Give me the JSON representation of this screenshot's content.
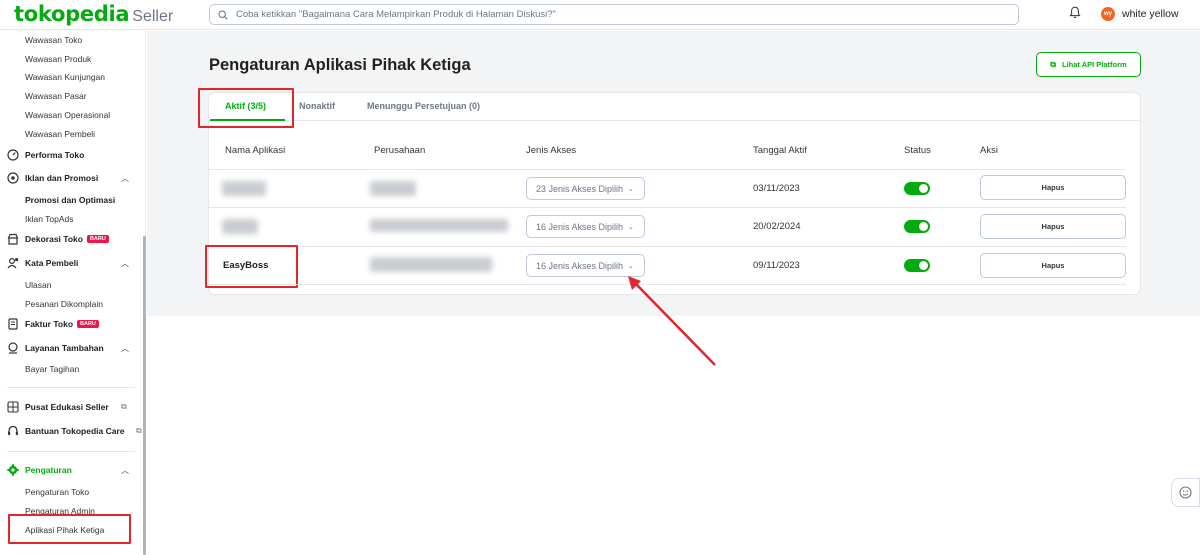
{
  "header": {
    "logo": "tokopedia",
    "logo_suffix": "Seller",
    "search_placeholder": "Coba ketikkan \"Bagaimana Cara Melampirkan Produk di Halaman Diskusi?\"",
    "avatar_text": "wy",
    "username": "white yellow"
  },
  "sidebar": {
    "wawasan_items": [
      "Wawasan Toko",
      "Wawasan Produk",
      "Wawasan Kunjungan",
      "Wawasan Pasar",
      "Wawasan Operasional",
      "Wawasan Pembeli"
    ],
    "performa": "Performa Toko",
    "iklan": "Iklan dan Promosi",
    "iklan_items": [
      "Promosi dan Optimasi",
      "Iklan TopAds"
    ],
    "dekorasi": "Dekorasi Toko",
    "badge_baru": "BARU",
    "kata_pembeli": "Kata Pembeli",
    "kata_items": [
      "Ulasan",
      "Pesanan Dikomplain"
    ],
    "faktur": "Faktur Toko",
    "layanan": "Layanan Tambahan",
    "layanan_items": [
      "Bayar Tagihan"
    ],
    "edukasi": "Pusat Edukasi Seller",
    "bantuan": "Bantuan Tokopedia Care",
    "pengaturan": "Pengaturan",
    "pengaturan_items": [
      "Pengaturan Toko",
      "Pengaturan Admin",
      "Aplikasi Pihak Ketiga"
    ]
  },
  "main": {
    "title": "Pengaturan Aplikasi Pihak Ketiga",
    "api_button": "Lihat API Platform",
    "tabs": [
      "Aktif (3/5)",
      "Nonaktif",
      "Menunggu Persetujuan (0)"
    ],
    "columns": [
      "Nama Aplikasi",
      "Perusahaan",
      "Jenis Akses",
      "Tanggal Aktif",
      "Status",
      "Aksi"
    ],
    "rows": [
      {
        "name": "",
        "access": "23 Jenis Akses Dipilih",
        "date": "03/11/2023",
        "action": "Hapus"
      },
      {
        "name": "",
        "access": "16 Jenis Akses Dipilih",
        "date": "20/02/2024",
        "action": "Hapus"
      },
      {
        "name": "EasyBoss",
        "access": "16 Jenis Akses Dipilih",
        "date": "09/11/2023",
        "action": "Hapus"
      }
    ]
  },
  "colors": {
    "brand_green": "#03ac0e",
    "highlight_red": "#e0262b",
    "badge_red": "#ef144a"
  }
}
